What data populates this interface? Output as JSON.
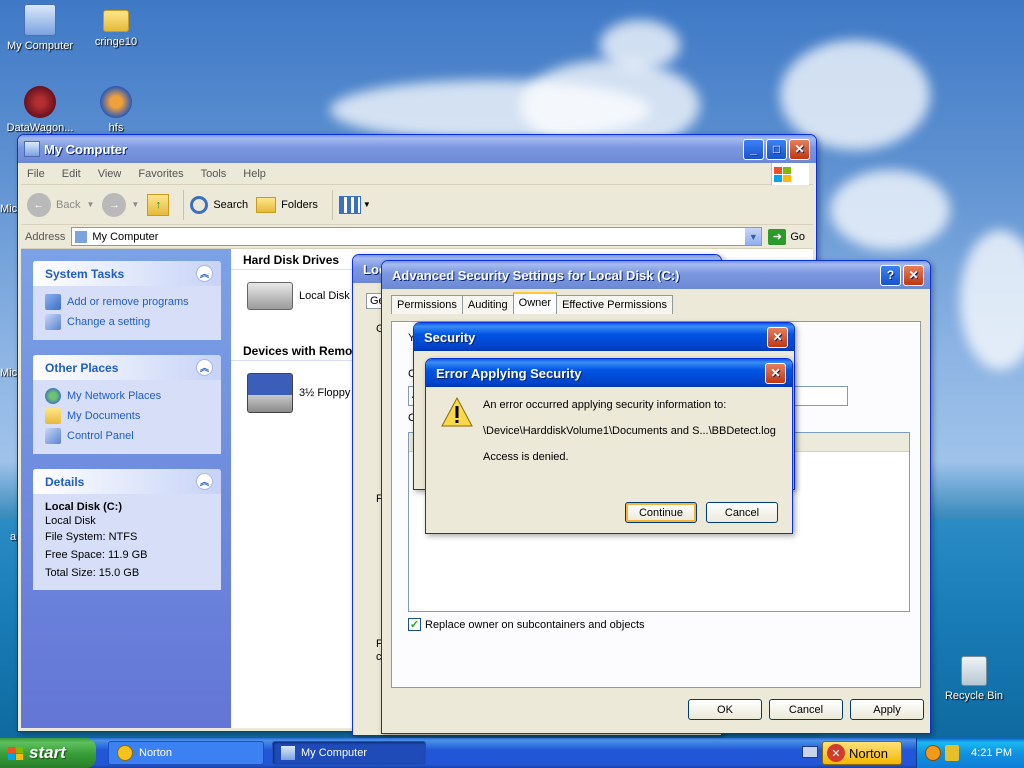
{
  "desktop": {
    "icons": [
      {
        "label": "My Computer"
      },
      {
        "label": "cringe10"
      },
      {
        "label": "DataWagon..."
      },
      {
        "label": "hfs"
      },
      {
        "label": "Recycle Bin"
      }
    ],
    "edge_labels": [
      "Mic",
      "Mic",
      "a"
    ]
  },
  "explorer": {
    "title": "My Computer",
    "menu": [
      "File",
      "Edit",
      "View",
      "Favorites",
      "Tools",
      "Help"
    ],
    "toolbar": {
      "back": "Back",
      "search": "Search",
      "folders": "Folders"
    },
    "address": {
      "label": "Address",
      "value": "My Computer",
      "go": "Go"
    },
    "system_tasks": {
      "title": "System Tasks",
      "items": [
        "Add or remove programs",
        "Change a setting"
      ]
    },
    "other_places": {
      "title": "Other Places",
      "items": [
        "My Network Places",
        "My Documents",
        "Control Panel"
      ]
    },
    "details": {
      "title": "Details",
      "name": "Local Disk (C:)",
      "type": "Local Disk",
      "file_system": "File System: NTFS",
      "free_space": "Free Space: 11.9 GB",
      "total_size": "Total Size: 15.0 GB"
    },
    "sections": {
      "hard_disks": "Hard Disk Drives",
      "removable": "Devices with Remo"
    },
    "drives": [
      "Local Disk (",
      "3½ Floppy"
    ]
  },
  "properties_window": {
    "title": "Loc",
    "tab": "Ge",
    "frag1": "G",
    "frag2": "F",
    "frag3": "F",
    "frag4": "c"
  },
  "advanced": {
    "title": "Advanced Security Settings for Local Disk (C:)",
    "tabs": [
      "Permissions",
      "Auditing",
      "Owner",
      "Effective Permissions"
    ],
    "active_tab": "Owner",
    "frags": [
      "Y",
      "C",
      "A",
      "C"
    ],
    "checkbox_label": "Replace owner on subcontainers and objects",
    "buttons": {
      "ok": "OK",
      "cancel": "Cancel",
      "apply": "Apply"
    }
  },
  "security_dialog": {
    "title": "Security"
  },
  "error_dialog": {
    "title": "Error Applying Security",
    "message": "An error occurred applying security information to:",
    "path": "\\Device\\HarddiskVolume1\\Documents and S...\\BBDetect.log",
    "detail": "Access is denied.",
    "buttons": {
      "continue": "Continue",
      "cancel": "Cancel"
    }
  },
  "taskbar": {
    "start": "start",
    "tasks": [
      {
        "label": "Norton"
      },
      {
        "label": "My Computer"
      }
    ],
    "norton": "Norton",
    "time": "4:21 PM"
  }
}
